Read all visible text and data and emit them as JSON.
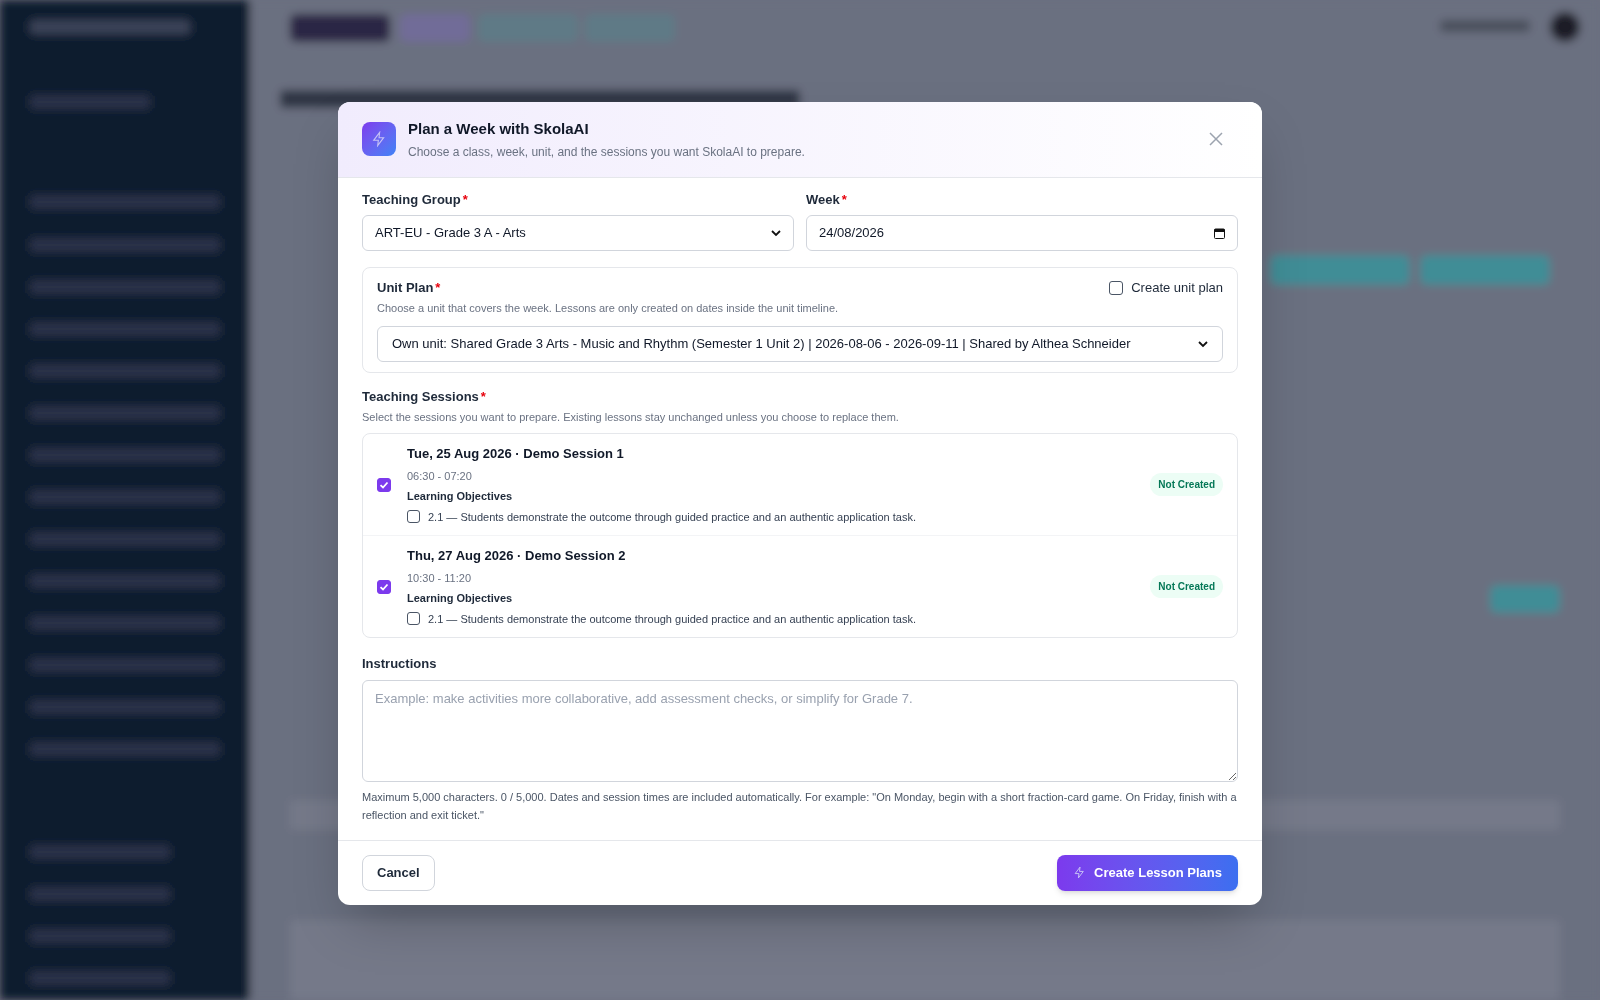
{
  "dialog": {
    "title": "Plan a Week with SkolaAI",
    "subtitle": "Choose a class, week, unit, and the sessions you want SkolaAI to prepare."
  },
  "teaching_group": {
    "label": "Teaching Group",
    "required_mark": "*",
    "value": "ART-EU - Grade 3 A - Arts"
  },
  "week": {
    "label": "Week",
    "required_mark": "*",
    "value": "24/08/2026"
  },
  "unit_plan": {
    "label": "Unit Plan",
    "required_mark": "*",
    "hint": "Choose a unit that covers the week. Lessons are only created on dates inside the unit timeline.",
    "create_unit_plan": {
      "label": "Create unit plan",
      "checked": false
    },
    "value": "Own unit: Shared Grade 3 Arts - Music and Rhythm (Semester 1 Unit 2) | 2026-08-06 - 2026-09-11 | Shared by Althea Schneider"
  },
  "teaching_sessions": {
    "label": "Teaching Sessions",
    "required_mark": "*",
    "hint": "Select the sessions you want to prepare. Existing lessons stay unchanged unless you choose to replace them.",
    "sessions": [
      {
        "title": "Tue, 25 Aug 2026 · Demo Session 1",
        "time": "06:30 - 07:20",
        "checked": true,
        "objectives_label": "Learning Objectives",
        "objectives": [
          {
            "text": "2.1 — Students demonstrate the outcome through guided practice and an authentic application task.",
            "checked": false
          }
        ],
        "status": "Not Created"
      },
      {
        "title": "Thu, 27 Aug 2026 · Demo Session 2",
        "time": "10:30 - 11:20",
        "checked": true,
        "objectives_label": "Learning Objectives",
        "objectives": [
          {
            "text": "2.1 — Students demonstrate the outcome through guided practice and an authentic application task.",
            "checked": false
          }
        ],
        "status": "Not Created"
      }
    ]
  },
  "instructions": {
    "label": "Instructions",
    "placeholder": "Example: make activities more collaborative, add assessment checks, or simplify for Grade 7.",
    "help": "Maximum 5,000 characters. 0 / 5,000. Dates and session times are included automatically. For example: \"On Monday, begin with a short fraction-card game. On Friday, finish with a reflection and exit ticket.\""
  },
  "buttons": [
    {
      "label": "Cancel",
      "kind": "secondary"
    },
    {
      "label": "Create Lesson Plans",
      "kind": "primary"
    }
  ]
}
